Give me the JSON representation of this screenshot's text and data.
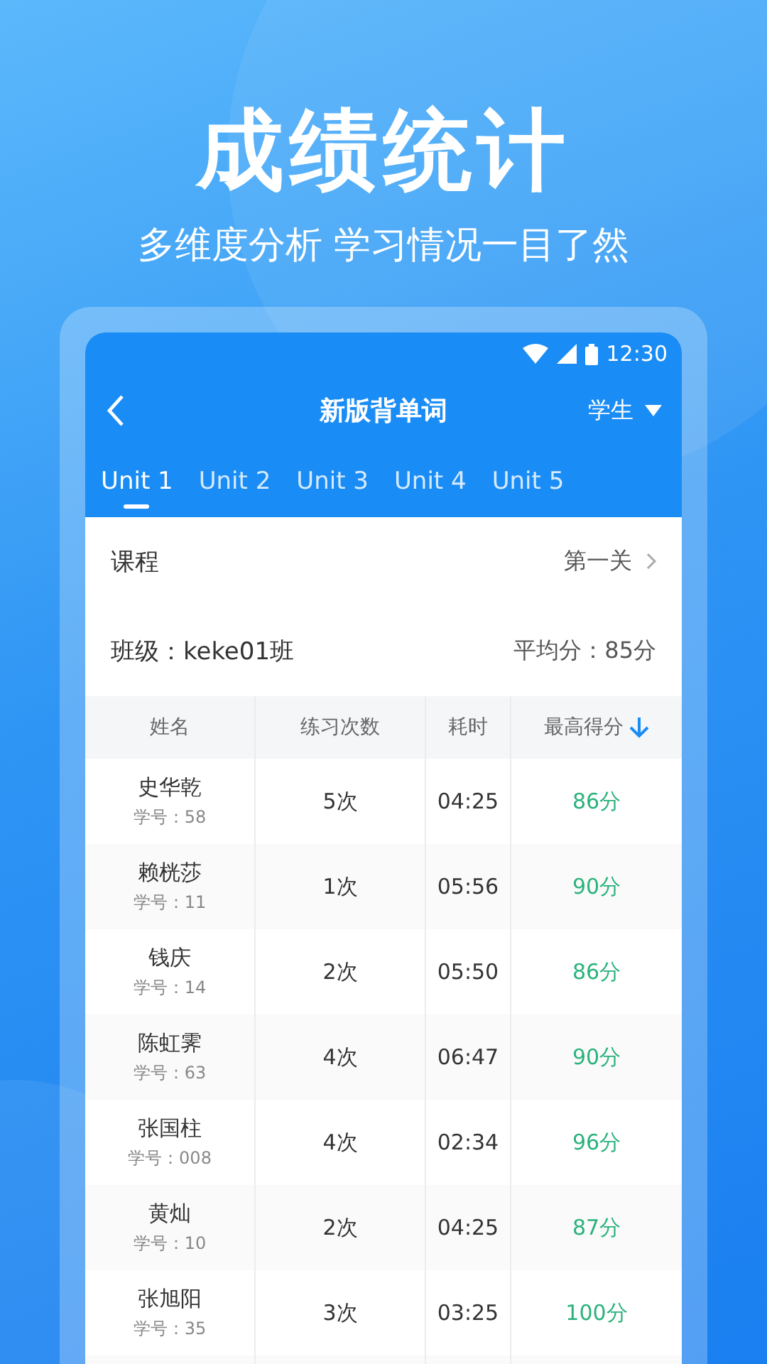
{
  "headline": "成绩统计",
  "subtitle": "多维度分析 学习情况一目了然",
  "status_bar": {
    "time": "12:30"
  },
  "header": {
    "title": "新版背单词",
    "role": "学生"
  },
  "tabs": [
    {
      "label": "Unit 1",
      "selected": true
    },
    {
      "label": "Unit 2",
      "selected": false
    },
    {
      "label": "Unit 3",
      "selected": false
    },
    {
      "label": "Unit 4",
      "selected": false
    },
    {
      "label": "Unit 5",
      "selected": false
    }
  ],
  "course": {
    "label": "课程",
    "value": "第一关"
  },
  "class_info": {
    "class": "班级：keke01班",
    "average": "平均分：85分"
  },
  "table": {
    "columns": [
      "姓名",
      "练习次数",
      "耗时",
      "最高得分"
    ],
    "rows": [
      {
        "name": "史华乾",
        "id": "学号：58",
        "count": "5次",
        "time": "04:25",
        "score": "86分"
      },
      {
        "name": "赖桄莎",
        "id": "学号：11",
        "count": "1次",
        "time": "05:56",
        "score": "90分"
      },
      {
        "name": "钱庆",
        "id": "学号：14",
        "count": "2次",
        "time": "05:50",
        "score": "86分"
      },
      {
        "name": "陈虹霁",
        "id": "学号：63",
        "count": "4次",
        "time": "06:47",
        "score": "90分"
      },
      {
        "name": "张国柱",
        "id": "学号：008",
        "count": "4次",
        "time": "02:34",
        "score": "96分"
      },
      {
        "name": "黄灿",
        "id": "学号：10",
        "count": "2次",
        "time": "04:25",
        "score": "87分"
      },
      {
        "name": "张旭阳",
        "id": "学号：35",
        "count": "3次",
        "time": "03:25",
        "score": "100分"
      }
    ]
  }
}
